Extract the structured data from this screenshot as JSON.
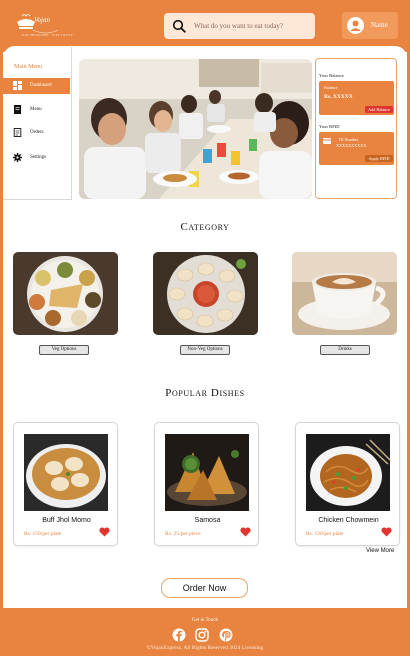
{
  "brand": {
    "name": "Vojan",
    "sub": "EAT HEALTHY · EAT TASTY"
  },
  "search": {
    "placeholder": "What do you want to eat today?"
  },
  "profile": {
    "name": "Name"
  },
  "sidebar": {
    "title": "Main Menu",
    "items": [
      {
        "label": "Dashboard",
        "icon": "dashboard-icon",
        "active": true
      },
      {
        "label": "Menu",
        "icon": "menu-book-icon"
      },
      {
        "label": "Orders",
        "icon": "orders-icon"
      },
      {
        "label": "Settings",
        "icon": "gear-icon"
      }
    ]
  },
  "wallet": {
    "balance_title": "Your Balance",
    "balance_label": "Balance",
    "balance_value": "Rs.  XXXXX",
    "add_balance": "Add Balance",
    "rfid_title": "Your RFID",
    "rfid_label": "ID Number",
    "rfid_value": "XXXXXXXXXX",
    "apply_rfid": "Apply RFID"
  },
  "category": {
    "title": "Category",
    "items": [
      {
        "label": "Veg Options"
      },
      {
        "label": "Non-Veg Options"
      },
      {
        "label": "Drinks"
      }
    ]
  },
  "popular": {
    "title": "Popular Dishes",
    "dishes": [
      {
        "name": "Buff Jhol Momo",
        "price": "Rs. 150/per plate"
      },
      {
        "name": "Samosa",
        "price": "Rs. 25/per piece"
      },
      {
        "name": "Chicken Chowmein",
        "price": "Rs. 120/per plate"
      }
    ],
    "view_more": "View More"
  },
  "order_now": "Order Now",
  "footer": {
    "touch": "Get in Touch",
    "copyright": "©VojanExpress, All Rights Reserved 2024 Licensing"
  },
  "colors": {
    "accent": "#e8843f",
    "accent_light": "#fde7d6",
    "danger": "#e0342e"
  }
}
